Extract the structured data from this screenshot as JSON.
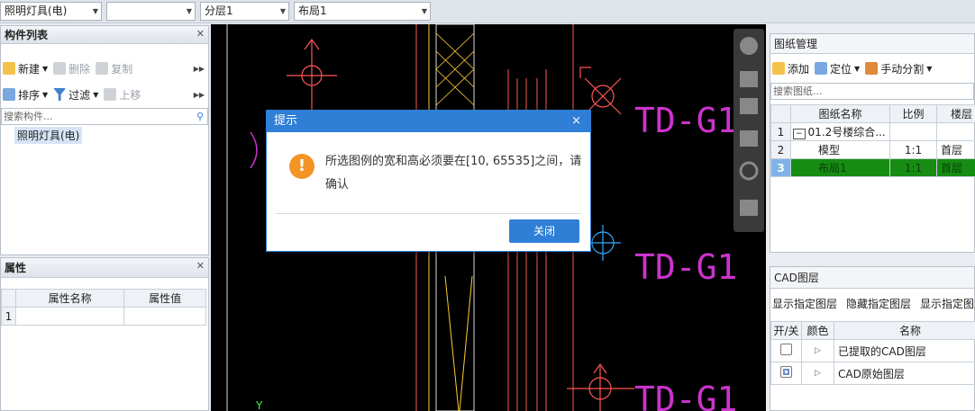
{
  "topbar": {
    "combo1": "照明灯具(电)",
    "combo2": "",
    "combo3": "分层1",
    "combo4": "布局1"
  },
  "component_panel": {
    "title": "构件列表",
    "new_label": "新建",
    "delete_label": "删除",
    "copy_label": "复制",
    "sort_label": "排序",
    "filter_label": "过滤",
    "moveup_label": "上移",
    "search_placeholder": "搜索构件...",
    "tree_item": "照明灯具(电)"
  },
  "property_panel": {
    "title": "属性",
    "col_name": "属性名称",
    "col_value": "属性值",
    "rows": [
      {
        "num": "1",
        "name": "",
        "value": ""
      }
    ]
  },
  "drawing_panel": {
    "title": "图纸管理",
    "add_label": "添加",
    "locate_label": "定位",
    "split_label": "手动分割",
    "search_placeholder": "搜索图纸...",
    "col_name": "图纸名称",
    "col_scale": "比例",
    "col_floor": "楼层",
    "rows": [
      {
        "num": "1",
        "name": "01.2号楼综合...",
        "scale": "",
        "floor": ""
      },
      {
        "num": "2",
        "name": "模型",
        "scale": "1:1",
        "floor": "首层"
      },
      {
        "num": "3",
        "name": "布局1",
        "scale": "1:1",
        "floor": "首层"
      }
    ]
  },
  "cad_panel": {
    "title": "CAD图层",
    "show_label": "显示指定图层",
    "hide_label": "隐藏指定图层",
    "show2_label": "显示指定图层",
    "col_toggle": "开/关",
    "col_color": "颜色",
    "col_name": "名称",
    "layers": [
      {
        "name": "已提取的CAD图层"
      },
      {
        "name": "CAD原始图层"
      }
    ]
  },
  "canvas": {
    "labels": [
      "TD-G1",
      "TD-G1",
      "TD-G1"
    ],
    "axis_y": "Y",
    "colors": {
      "magenta": "#cc33cc",
      "cyan": "#33aaff",
      "red": "#ff5555",
      "yellow": "#ffcc33",
      "white": "#dddddd"
    }
  },
  "dialog": {
    "title": "提示",
    "close_x": "×",
    "message": "所选图例的宽和高必须要在[10, 65535]之间，请确认",
    "close_button": "关闭",
    "icon": "warning-icon"
  }
}
